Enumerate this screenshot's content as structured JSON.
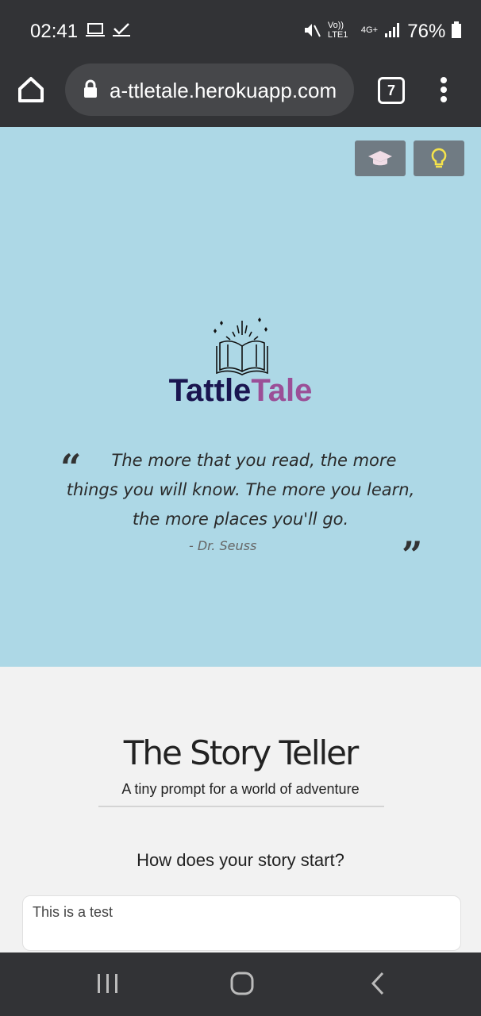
{
  "status_bar": {
    "time": "02:41",
    "network": "Vo)) LTE1",
    "network_type": "4G+",
    "battery": "76%"
  },
  "browser": {
    "url": "a-ttletale.herokuapp.com",
    "tab_count": "7"
  },
  "hero": {
    "logo_part1": "Tattle",
    "logo_part2": "Tale",
    "quote": "The more that you read, the more things you will know. The more you learn, the more places you'll go.",
    "author": "- Dr. Seuss",
    "colors": {
      "background": "#add8e6",
      "brand_dark": "#1a1550",
      "brand_accent": "#9b4f97"
    }
  },
  "story_section": {
    "title": "The Story Teller",
    "subtitle": "A tiny prompt for a world of adventure",
    "question": "How does your story start?",
    "input_value": "This is a test"
  },
  "icons": [
    "home-icon",
    "lock-icon",
    "tabs-icon",
    "menu-icon",
    "graduation-cap-icon",
    "lightbulb-icon",
    "open-book-icon",
    "quote-open-icon",
    "quote-close-icon",
    "recent-apps-icon",
    "home-nav-icon",
    "back-icon"
  ]
}
